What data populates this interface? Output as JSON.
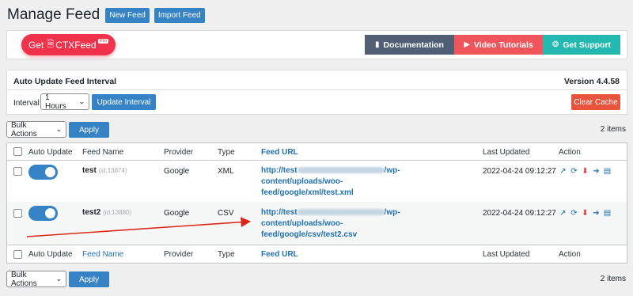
{
  "header": {
    "title": "Manage Feed",
    "new_feed": "New Feed",
    "import_feed": "Import Feed"
  },
  "promo": {
    "get_label": "Get",
    "brand": "CTXFeed",
    "pro_badge": "Pro",
    "links": {
      "documentation": "Documentation",
      "videos": "Video Tutorials",
      "support": "Get Support"
    }
  },
  "interval": {
    "title": "Auto Update Feed Interval",
    "version": "Version 4.4.58",
    "label": "Interval",
    "selected": "1 Hours",
    "update_btn": "Update Interval",
    "clear_btn": "Clear Cache"
  },
  "bulk": {
    "label": "Bulk Actions",
    "apply": "Apply",
    "count": "2 items"
  },
  "table": {
    "columns": {
      "auto_update": "Auto Update",
      "feed_name": "Feed Name",
      "provider": "Provider",
      "type": "Type",
      "feed_url": "Feed URL",
      "last_updated": "Last Updated",
      "action": "Action"
    },
    "rows": [
      {
        "name": "test",
        "id": "(id:13874)",
        "provider": "Google",
        "type": "XML",
        "url_prefix": "http://test",
        "url_rest1": "/wp-content/uploads/woo-",
        "url_rest2": "feed/google/xml/test.xml",
        "updated": "2022-04-24 09:12:27"
      },
      {
        "name": "test2",
        "id": "(id:13880)",
        "provider": "Google",
        "type": "CSV",
        "url_prefix": "http://test",
        "url_rest1": "/wp-content/uploads/woo-",
        "url_rest2": "feed/google/csv/test2.csv",
        "updated": "2022-04-24 09:12:27"
      }
    ]
  },
  "colors": {
    "primary": "#3582c4",
    "promo_red": "#f0334b",
    "doc_bg": "#505f75",
    "video_bg": "#f0555c",
    "support_bg": "#23b9b0",
    "clear_bg": "#e8543e",
    "arrow": "#d9261c"
  }
}
